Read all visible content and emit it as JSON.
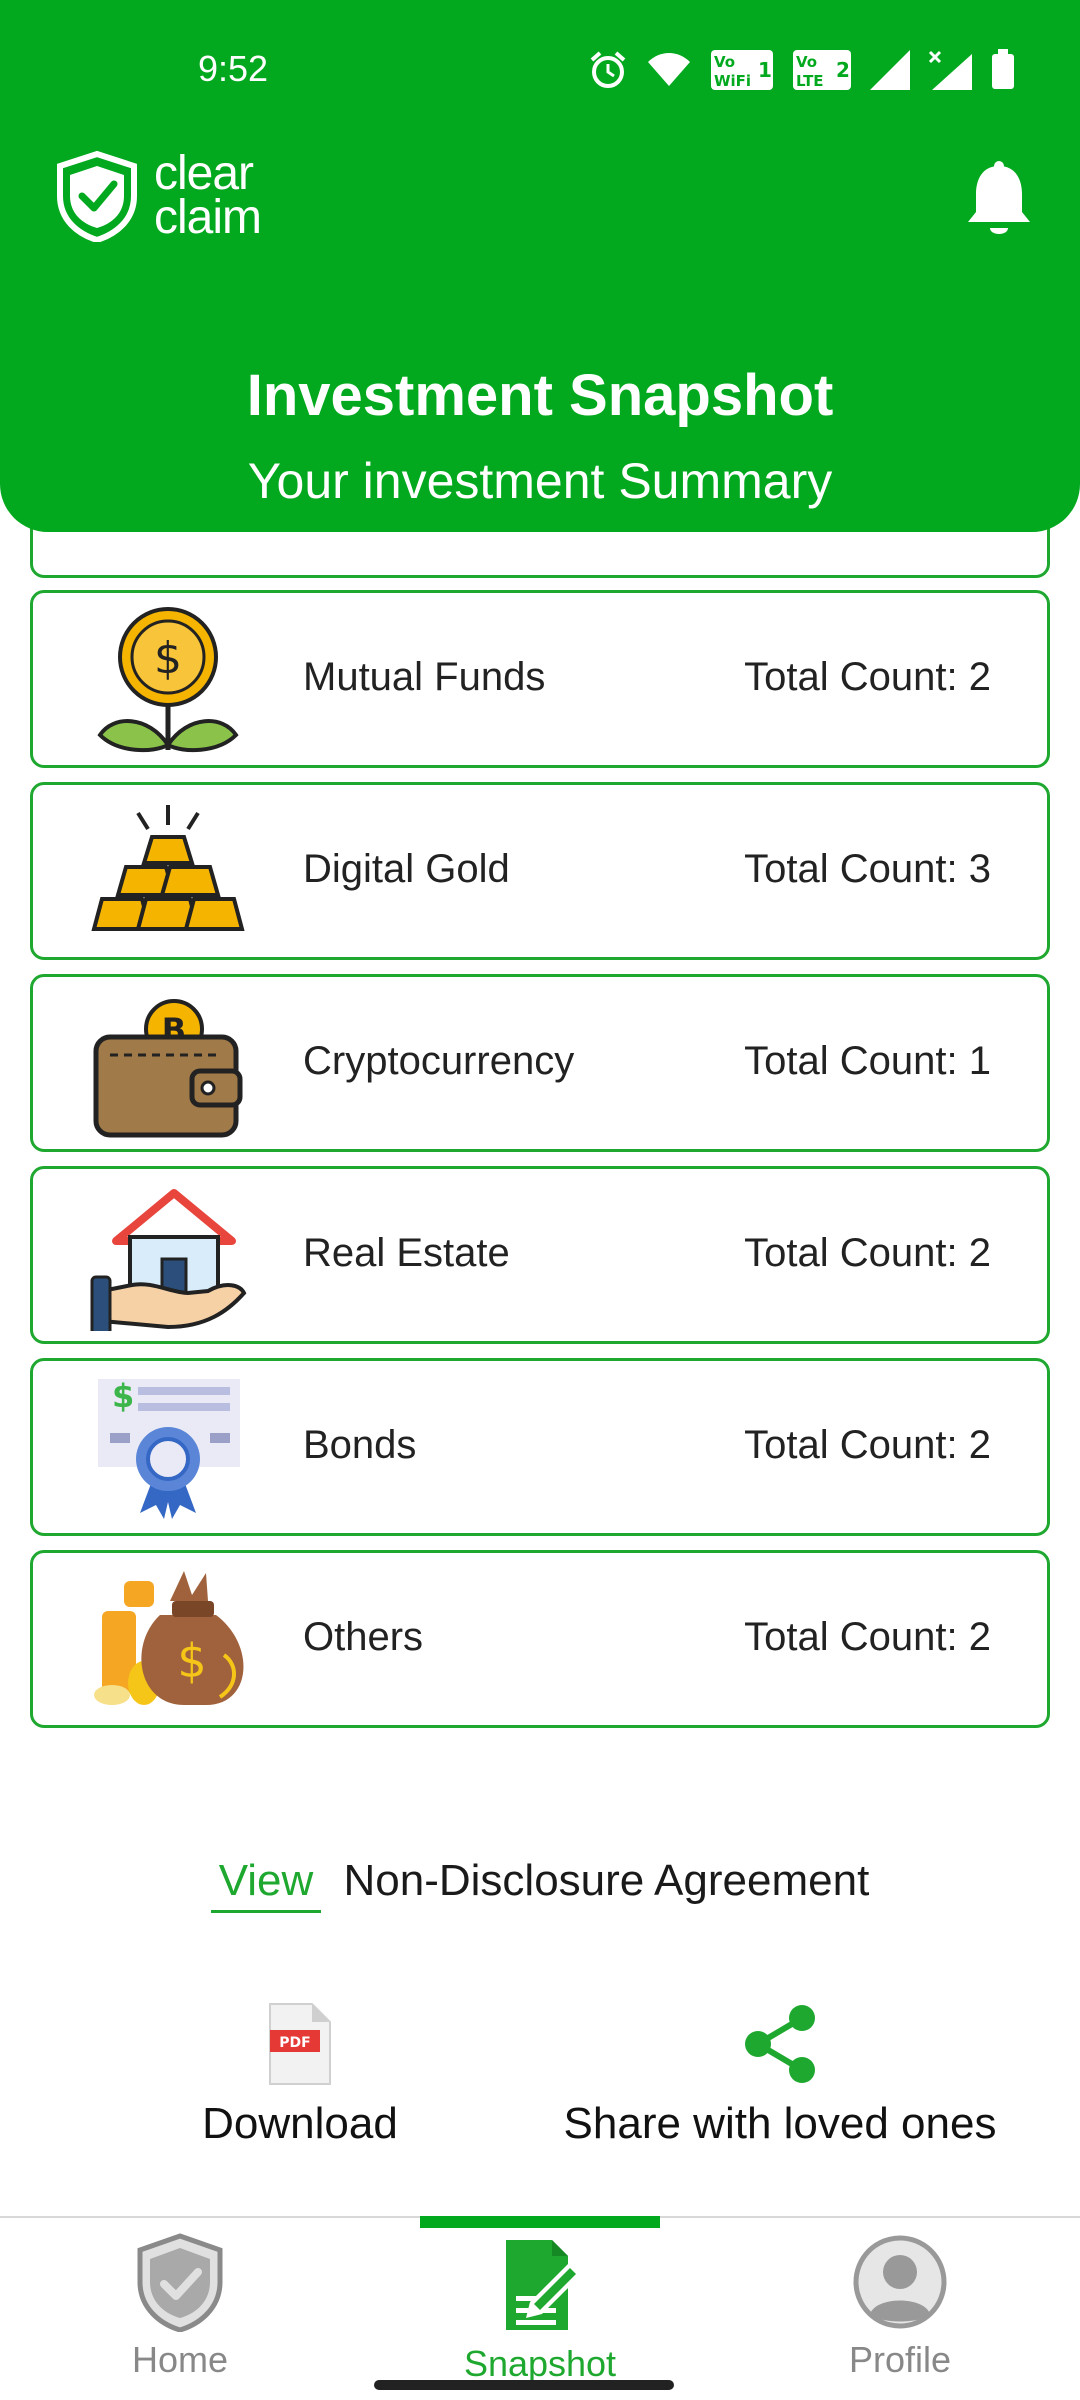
{
  "status_bar": {
    "time": "9:52",
    "icons": [
      "alarm-icon",
      "wifi-icon",
      "vowifi-icon",
      "volte-icon",
      "signal-icon",
      "signal-x-icon",
      "battery-icon"
    ],
    "vowifi": [
      "Vo",
      "WiFi",
      "1"
    ],
    "volte": [
      "Vo",
      "LTE",
      "2"
    ]
  },
  "header": {
    "logo_line1": "clear",
    "logo_line2": "claim",
    "title": "Investment Snapshot",
    "subtitle": "Your investment Summary",
    "bg_color": "#02a91e"
  },
  "investments": [
    {
      "name": "Mutual Funds",
      "count": "Total Count: 2",
      "icon": "money-plant-icon"
    },
    {
      "name": "Digital Gold",
      "count": "Total Count: 3",
      "icon": "gold-bars-icon"
    },
    {
      "name": "Cryptocurrency",
      "count": "Total Count: 1",
      "icon": "crypto-wallet-icon"
    },
    {
      "name": "Real Estate",
      "count": "Total Count: 2",
      "icon": "house-hand-icon"
    },
    {
      "name": "Bonds",
      "count": "Total Count: 2",
      "icon": "bond-certificate-icon"
    },
    {
      "name": "Others",
      "count": "Total Count: 2",
      "icon": "money-bag-icon"
    }
  ],
  "nda": {
    "link": "View",
    "label": "Non-Disclosure Agreement"
  },
  "actions": {
    "download": "Download",
    "download_badge": "PDF",
    "share": "Share with loved ones"
  },
  "nav": {
    "home": "Home",
    "snapshot": "Snapshot",
    "profile": "Profile",
    "active": "Snapshot",
    "accent": "#1fa82f"
  }
}
